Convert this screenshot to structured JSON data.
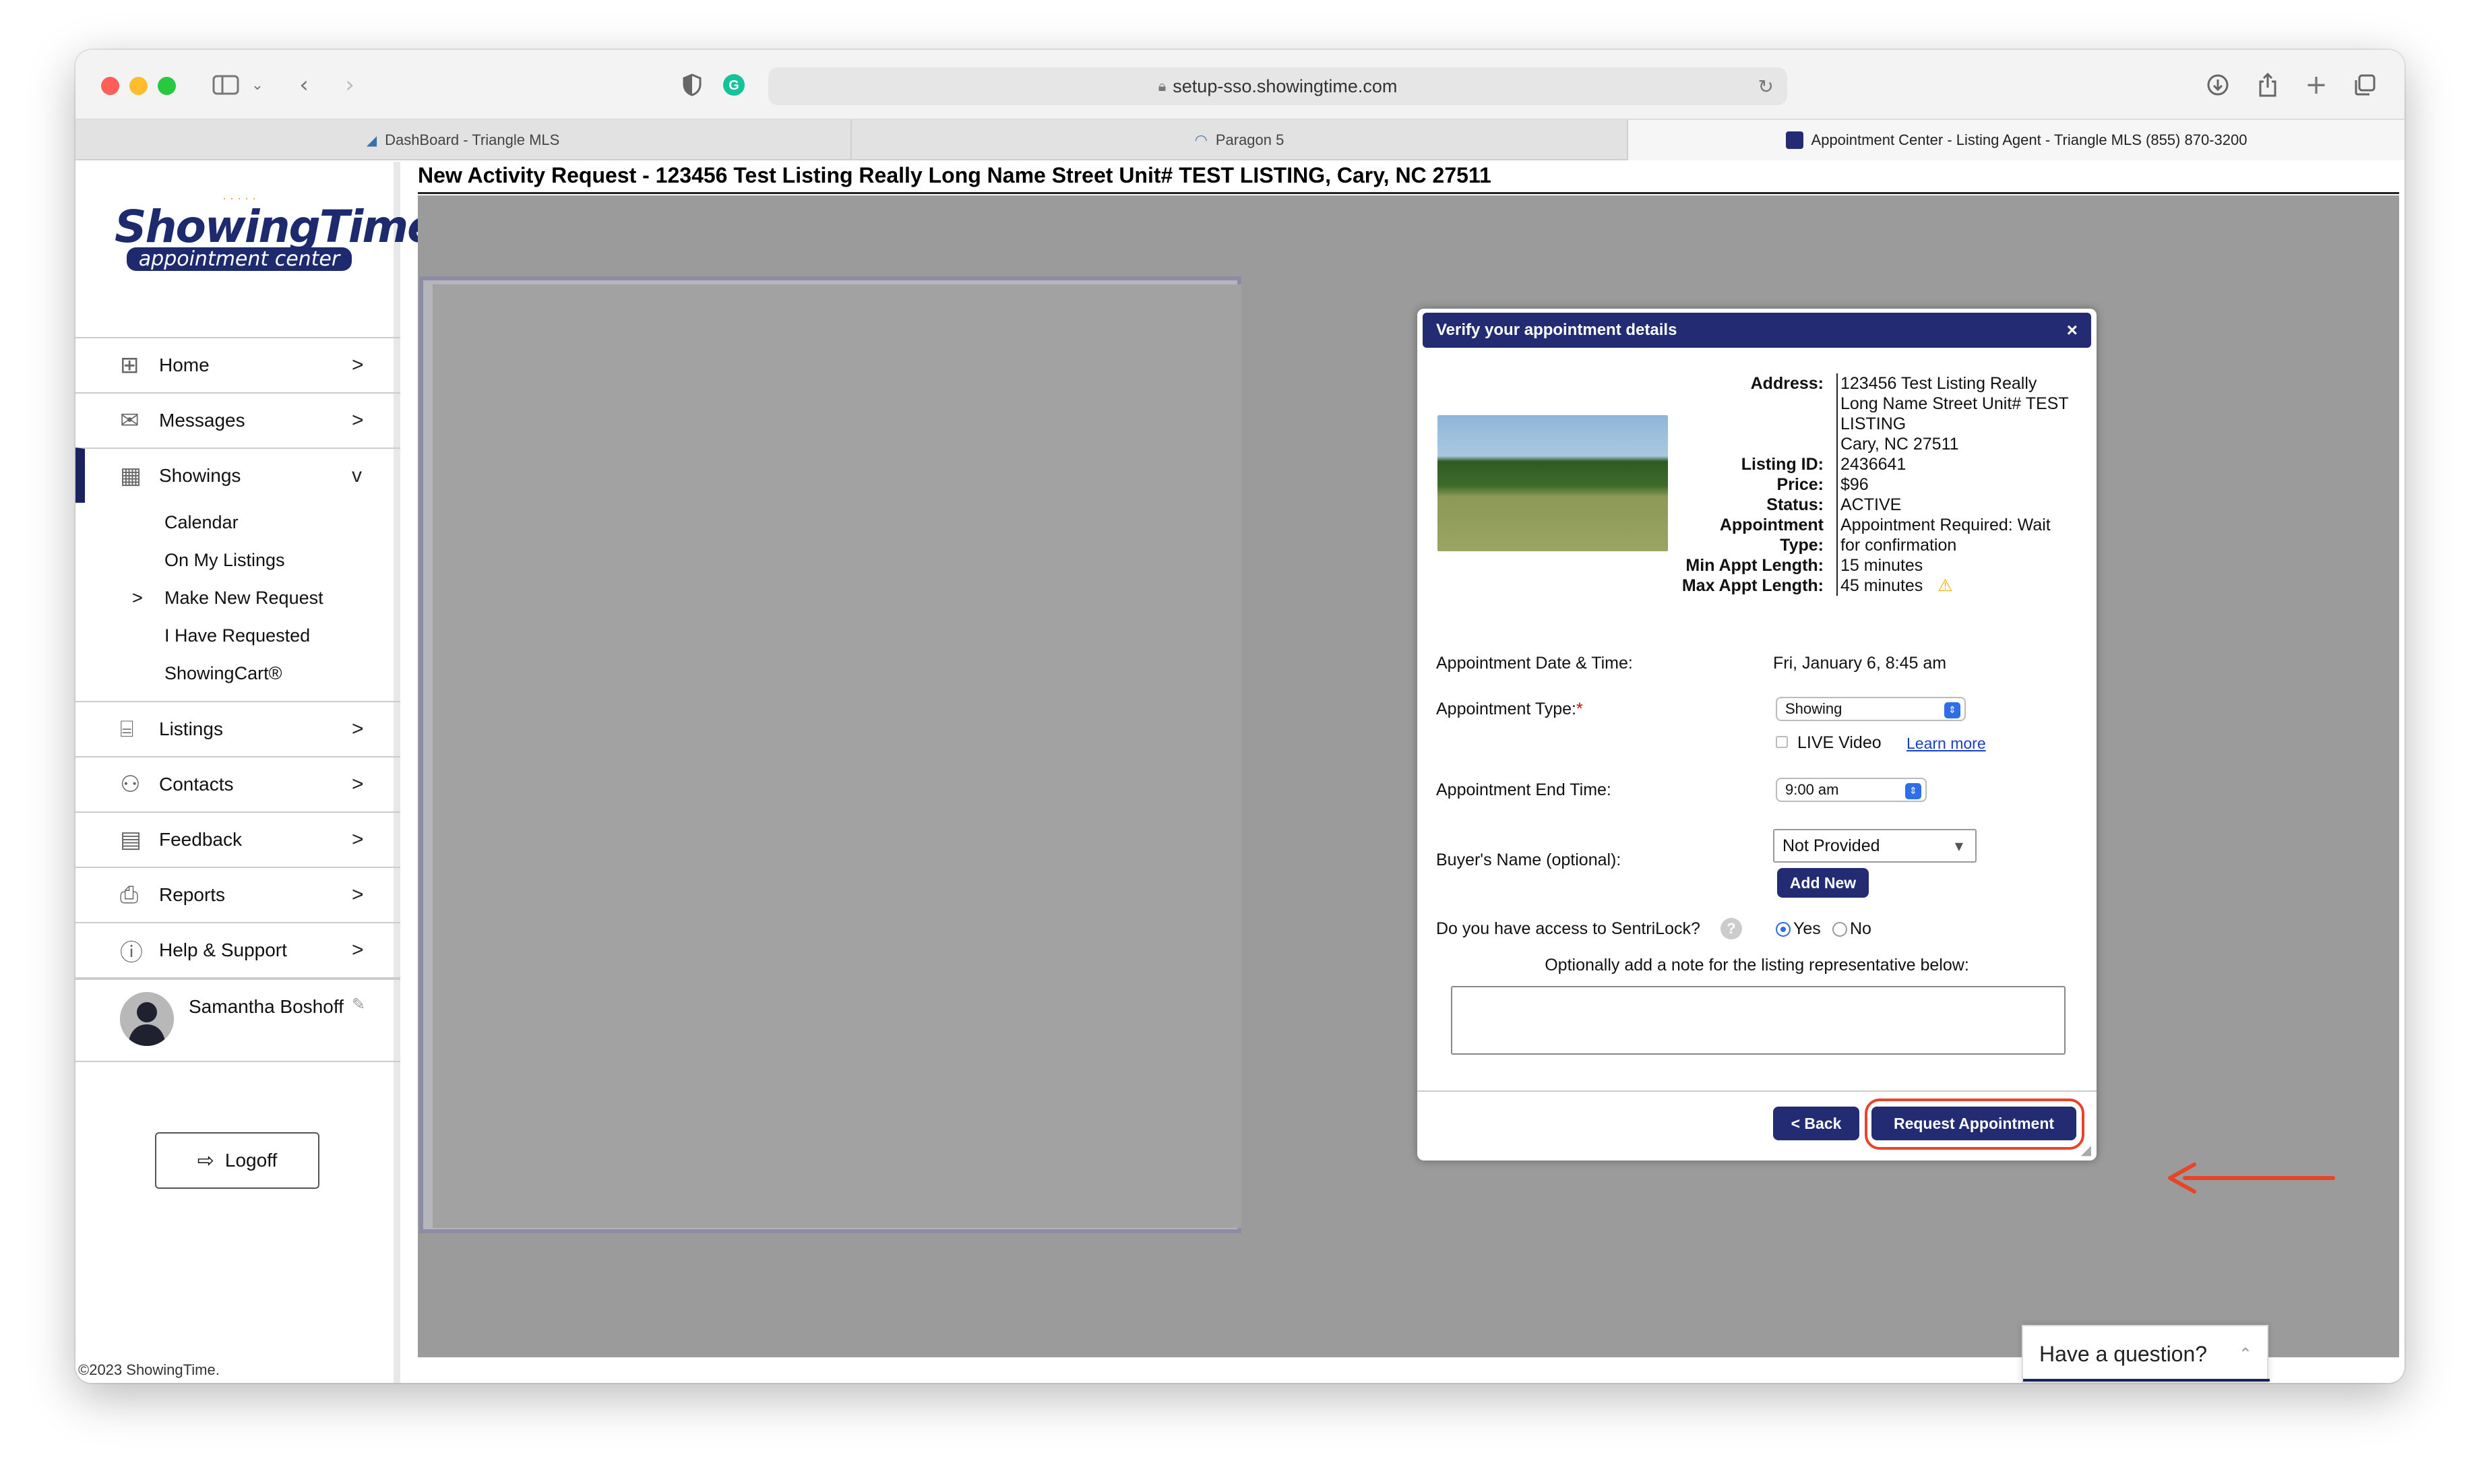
{
  "browser": {
    "url": "setup-sso.showingtime.com",
    "tabs": [
      {
        "label": "DashBoard - Triangle MLS"
      },
      {
        "label": "Paragon 5"
      },
      {
        "label": "Appointment Center - Listing Agent - Triangle MLS (855) 870-3200"
      }
    ]
  },
  "logo": {
    "main": "ShowingTime",
    "tm": "™",
    "sub": "appointment center"
  },
  "nav": {
    "items": [
      {
        "label": "Home",
        "chev": ">"
      },
      {
        "label": "Messages",
        "chev": ">"
      },
      {
        "label": "Showings",
        "chev": "v"
      },
      {
        "label": "Listings",
        "chev": ">"
      },
      {
        "label": "Contacts",
        "chev": ">"
      },
      {
        "label": "Feedback",
        "chev": ">"
      },
      {
        "label": "Reports",
        "chev": ">"
      },
      {
        "label": "Help & Support",
        "chev": ">"
      }
    ],
    "showings_sub": [
      "Calendar",
      "On My Listings",
      "Make New Request",
      "I Have Requested",
      "ShowingCart®"
    ],
    "sub_marker": ">"
  },
  "user": {
    "name": "Samantha Boshoff"
  },
  "logoff": {
    "label": "Logoff"
  },
  "footer": {
    "copyright": "©2023 ShowingTime."
  },
  "page": {
    "title": "New Activity Request - 123456 Test Listing Really Long Name Street Unit# TEST LISTING, Cary, NC 27511"
  },
  "modal": {
    "title": "Verify your appointment details",
    "close": "×",
    "details": {
      "address_label": "Address:",
      "address_value": [
        "123456 Test Listing Really",
        "Long Name Street Unit# TEST",
        "LISTING",
        "Cary, NC 27511"
      ],
      "listing_id_label": "Listing ID:",
      "listing_id_value": "2436641",
      "price_label": "Price:",
      "price_value": "$96",
      "status_label": "Status:",
      "status_value": "ACTIVE",
      "appt_type_label_1": "Appointment",
      "appt_type_label_2": "Type:",
      "appt_type_value_1": "Appointment Required: Wait",
      "appt_type_value_2": "for confirmation",
      "min_len_label": "Min Appt Length:",
      "min_len_value": "15 minutes",
      "max_len_label": "Max Appt Length:",
      "max_len_value": "45 minutes"
    },
    "form": {
      "date_label": "Appointment Date & Time:",
      "date_value": "Fri, January 6, 8:45 am",
      "type_label": "Appointment Type:",
      "required_mark": "*",
      "type_value": "Showing",
      "live_video_label": "LIVE Video",
      "learn_more": "Learn more",
      "end_time_label": "Appointment End Time:",
      "end_time_value": "9:00 am",
      "buyer_label": "Buyer's Name (optional):",
      "buyer_value": "Not Provided",
      "add_new": "Add New",
      "sentrilock_label": "Do you have access to SentriLock?",
      "yes_label": "Yes",
      "no_label": "No",
      "sentrilock_choice": "Yes",
      "note_prompt": "Optionally add a note for the listing representative below:",
      "note_value": ""
    },
    "back_label": "< Back",
    "request_label": "Request Appointment"
  },
  "help": {
    "label": "Have a question?"
  },
  "colors": {
    "navy": "#232c73",
    "annotation": "#e8442b"
  }
}
